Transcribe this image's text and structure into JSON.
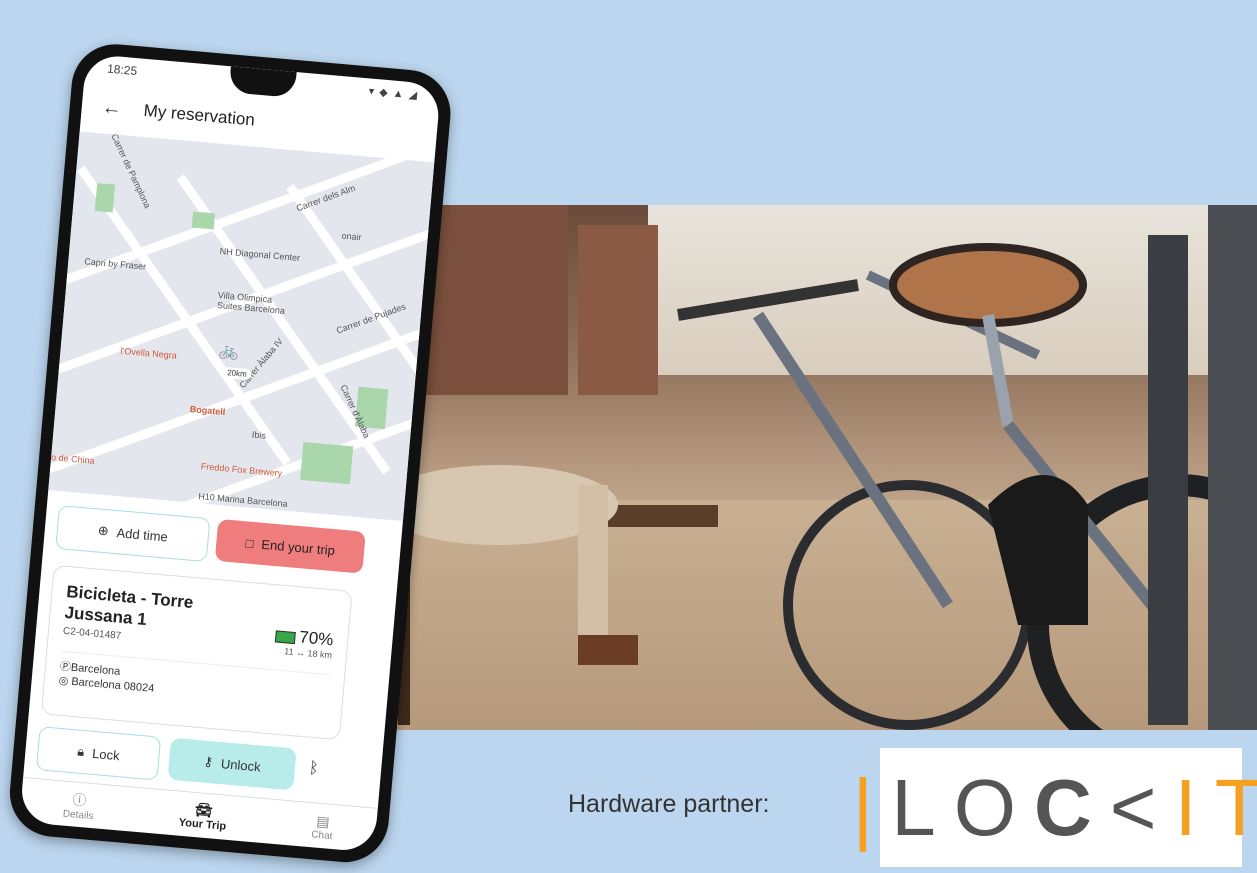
{
  "phone": {
    "status_time": "18:25",
    "status_icons": "▾ ◆ ▲ ◢",
    "title": "My reservation",
    "map_labels": [
      {
        "text": "Carrer de Pamplona"
      },
      {
        "text": "Carrer dels Alm"
      },
      {
        "text": "onair"
      },
      {
        "text": "NH Diagonal Center"
      },
      {
        "text": "Capri by Fraser"
      },
      {
        "text": "Villa Olimpica Suites Barcelona"
      },
      {
        "text": "Carrer de Pujades"
      },
      {
        "text": "Carrer Àlaba IV"
      },
      {
        "text": "20km"
      },
      {
        "text": "l'Ovella Negra"
      },
      {
        "text": "Bogatell"
      },
      {
        "text": "Ibis"
      },
      {
        "text": "Carrer d'Àlaba"
      },
      {
        "text": "Freddo Fox Brewery"
      },
      {
        "text": "o de China"
      },
      {
        "text": "H10 Marina Barcelona"
      }
    ],
    "add_time": "Add time",
    "end_trip": "End your trip",
    "bike_name": "Bicicleta - Torre Jussana 1",
    "bike_code": "C2-04-01487",
    "battery": "70%",
    "range": "11 ↔ 18 km",
    "city": "Barcelona",
    "address": "Barcelona 08024",
    "lock": "Lock",
    "unlock": "Unlock",
    "nav": [
      "Details",
      "Your Trip",
      "Chat"
    ]
  },
  "partner_label": "Hardware partner:",
  "logo_text": "LOCKIT",
  "colors": {
    "background": "#bcd6ef",
    "end_trip": "#f07d7d",
    "unlock": "#b8ecea",
    "logo_accent": "#f4a020"
  }
}
